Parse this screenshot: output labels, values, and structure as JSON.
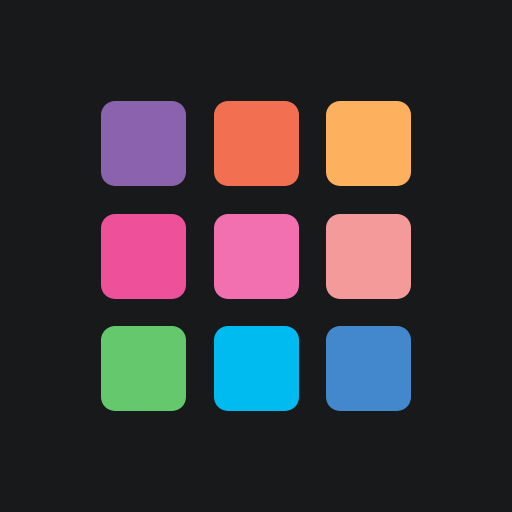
{
  "app": {
    "background": "#18191b"
  },
  "tiles": [
    {
      "color": "#8a62ad"
    },
    {
      "color": "#f26f52"
    },
    {
      "color": "#fdb05e"
    },
    {
      "color": "#ee5199"
    },
    {
      "color": "#f26fb0"
    },
    {
      "color": "#f59a9b"
    },
    {
      "color": "#65c86c"
    },
    {
      "color": "#00bbef"
    },
    {
      "color": "#4388cc"
    }
  ]
}
